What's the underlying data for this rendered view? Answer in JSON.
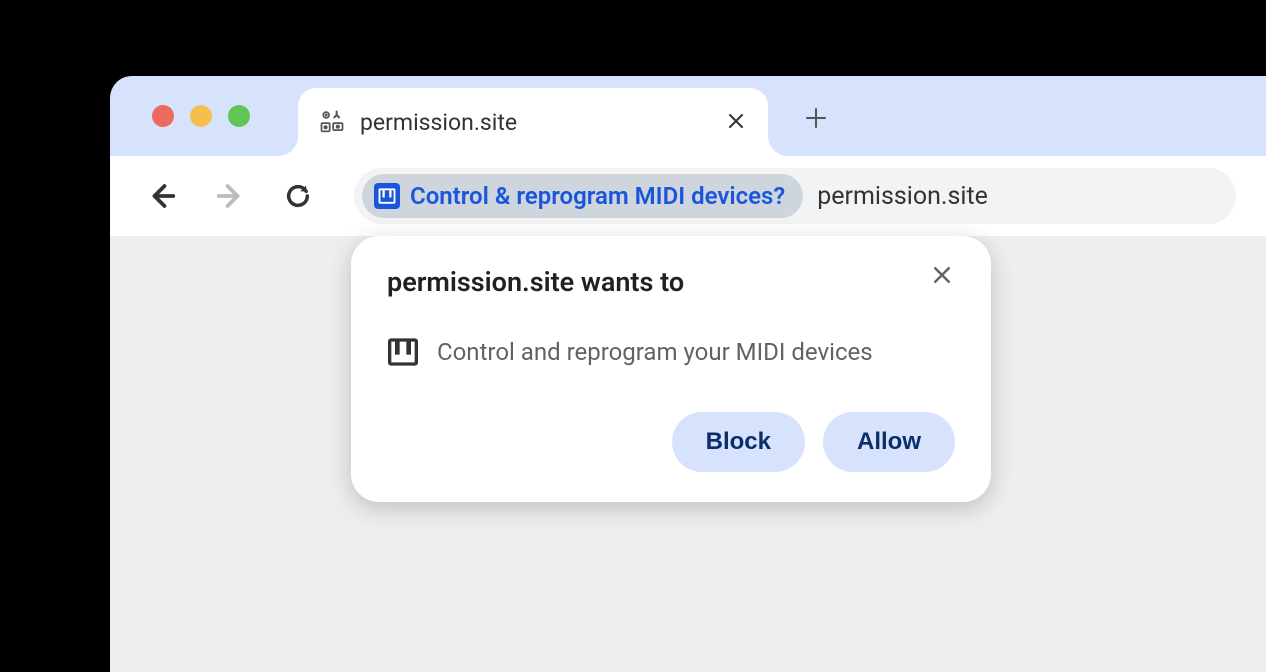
{
  "tab": {
    "title": "permission.site"
  },
  "addressBar": {
    "chipText": "Control & reprogram MIDI devices?",
    "url": "permission.site"
  },
  "dialog": {
    "title": "permission.site wants to",
    "bodyText": "Control and reprogram your MIDI devices",
    "blockLabel": "Block",
    "allowLabel": "Allow"
  }
}
